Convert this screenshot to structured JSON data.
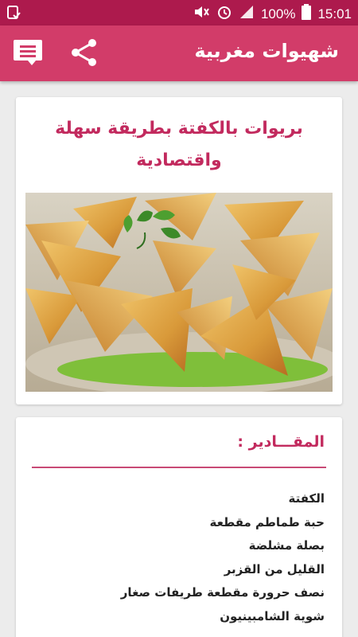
{
  "status_bar": {
    "time": "15:01",
    "battery": "100%",
    "icons": [
      "notification-icon",
      "mute-icon",
      "alarm-icon",
      "signal-icon",
      "battery-icon"
    ]
  },
  "app_bar": {
    "title": "شهيوات مغربية",
    "icons": [
      "message-menu-icon",
      "share-icon"
    ]
  },
  "recipe": {
    "title_line1": "بريوات بالكفتة بطريقة سهلة",
    "title_line2": "واقتصادية"
  },
  "ingredients": {
    "heading": "المقـــادير :",
    "items": [
      "الكفتة",
      "حبة طماطم مقطعة",
      "بصلة مشلضة",
      "القليل من القزبر",
      "نصف حرورة مقطعة طريفات صغار",
      "شوية الشامبينيون"
    ]
  },
  "colors": {
    "status_bar": "#ad1a4d",
    "app_bar": "#d23c69",
    "accent_text": "#c22a5e",
    "background": "#ececec"
  }
}
